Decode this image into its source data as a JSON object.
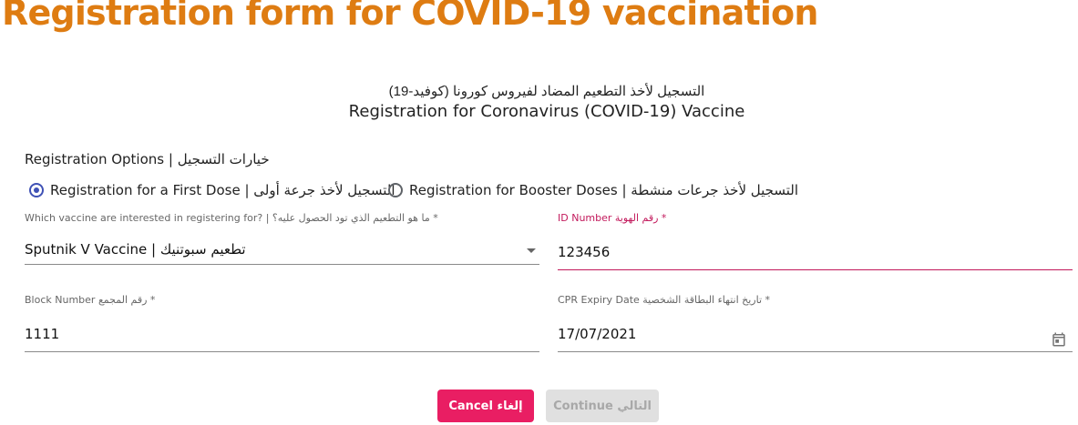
{
  "page": {
    "title": "Registration form for COVID-19 vaccination",
    "subtitle_ar": "التسجيل لأخذ التطعيم المضاد لفيروس كورونا (كوفيد-19)",
    "subtitle_en": "Registration for Coronavirus (COVID-19) Vaccine"
  },
  "registration_options": {
    "label": "Registration Options | خيارات التسجيل",
    "options": [
      {
        "label": "Registration for a First Dose | التسجيل لأخذ جرعة أولى",
        "selected": true
      },
      {
        "label": "Registration for Booster Doses | التسجيل لأخذ جرعات منشطة",
        "selected": false
      }
    ]
  },
  "fields": {
    "vaccine": {
      "label": "Which vaccine are interested in registering for? | ما هو التطعيم الذي تود الحصول عليه؟ *",
      "value": "Sputnik V Vaccine | تطعيم سبوتنيك",
      "icon": "chevron-down-icon"
    },
    "id_number": {
      "label": "ID Number رقم الهوية *",
      "value": "123456"
    },
    "block_number": {
      "label": "Block Number رقم المجمع *",
      "value": "1111"
    },
    "cpr_expiry": {
      "label": "CPR Expiry Date تاريخ انتهاء البطاقة الشخصية *",
      "value": "17/07/2021",
      "icon": "calendar-icon"
    }
  },
  "actions": {
    "cancel_label": "Cancel إلغاء",
    "continue_label": "Continue التالي"
  },
  "colors": {
    "title": "#de7c12",
    "primary": "#3f51b5",
    "accent": "#e91e63",
    "focus": "#c2185b",
    "disabled_bg": "#e0e0e0",
    "disabled_text": "#a8a8a8"
  }
}
